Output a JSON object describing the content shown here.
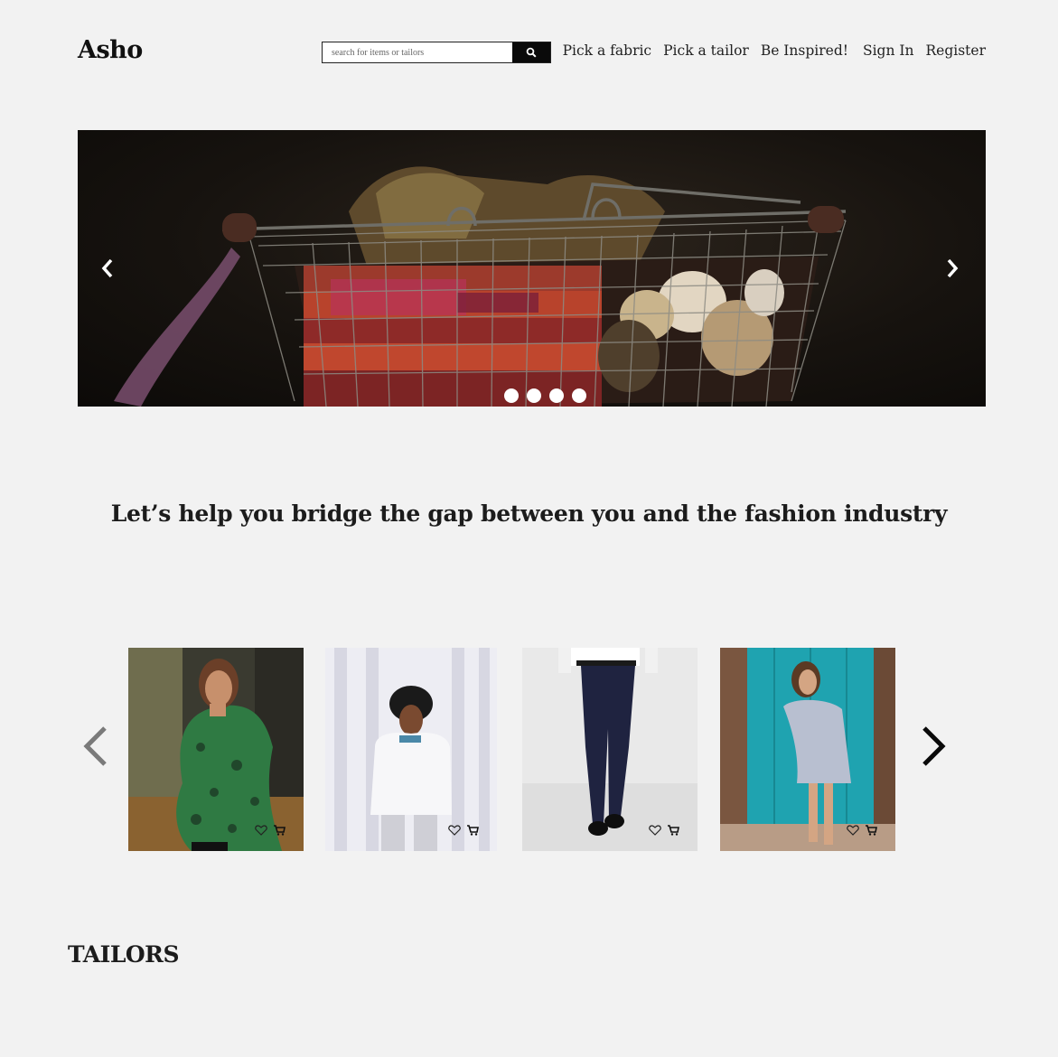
{
  "brand": {
    "name": "Asho"
  },
  "search": {
    "placeholder": "search for items or tailors",
    "button_icon": "search-icon"
  },
  "nav": {
    "items": [
      {
        "label": "Pick a fabric"
      },
      {
        "label": "Pick a tailor"
      },
      {
        "label": "Be Inspired!"
      },
      {
        "label": "Sign In"
      },
      {
        "label": "Register"
      }
    ]
  },
  "hero": {
    "slide_count": 4,
    "prev_icon": "chevron-left-icon",
    "next_icon": "chevron-right-icon"
  },
  "tagline": "Let’s help you bridge the gap between you and the fashion industry",
  "products": {
    "items": [
      {
        "icons": [
          "heart-icon",
          "cart-icon"
        ]
      },
      {
        "icons": [
          "heart-icon",
          "cart-icon"
        ]
      },
      {
        "icons": [
          "heart-icon",
          "cart-icon"
        ]
      },
      {
        "icons": [
          "heart-icon",
          "cart-icon"
        ]
      }
    ]
  },
  "sections": {
    "tailors_heading": "TAILORS"
  },
  "colors": {
    "background": "#f2f2f2",
    "search_button": "#0a0a0a",
    "text": "#1a1a1a"
  }
}
